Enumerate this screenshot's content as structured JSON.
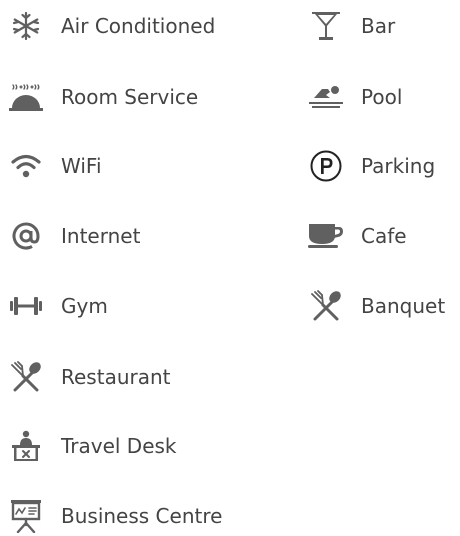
{
  "amenities": {
    "left": [
      {
        "label": "Air Conditioned",
        "icon": "snowflake-icon"
      },
      {
        "label": "Room Service",
        "icon": "room-service-cloche-icon"
      },
      {
        "label": "WiFi",
        "icon": "wifi-icon"
      },
      {
        "label": "Internet",
        "icon": "at-sign-icon"
      },
      {
        "label": "Gym",
        "icon": "dumbbell-icon"
      },
      {
        "label": "Restaurant",
        "icon": "fork-spoon-icon"
      },
      {
        "label": "Travel Desk",
        "icon": "travel-desk-icon"
      },
      {
        "label": "Business Centre",
        "icon": "presentation-board-icon"
      }
    ],
    "right": [
      {
        "label": "Bar",
        "icon": "cocktail-glass-icon"
      },
      {
        "label": "Pool",
        "icon": "swimmer-icon"
      },
      {
        "label": "Parking",
        "icon": "parking-icon"
      },
      {
        "label": "Cafe",
        "icon": "coffee-cup-icon"
      },
      {
        "label": "Banquet",
        "icon": "fork-spoon-icon"
      }
    ]
  },
  "colors": {
    "icon": "#606060",
    "text": "#444444"
  }
}
